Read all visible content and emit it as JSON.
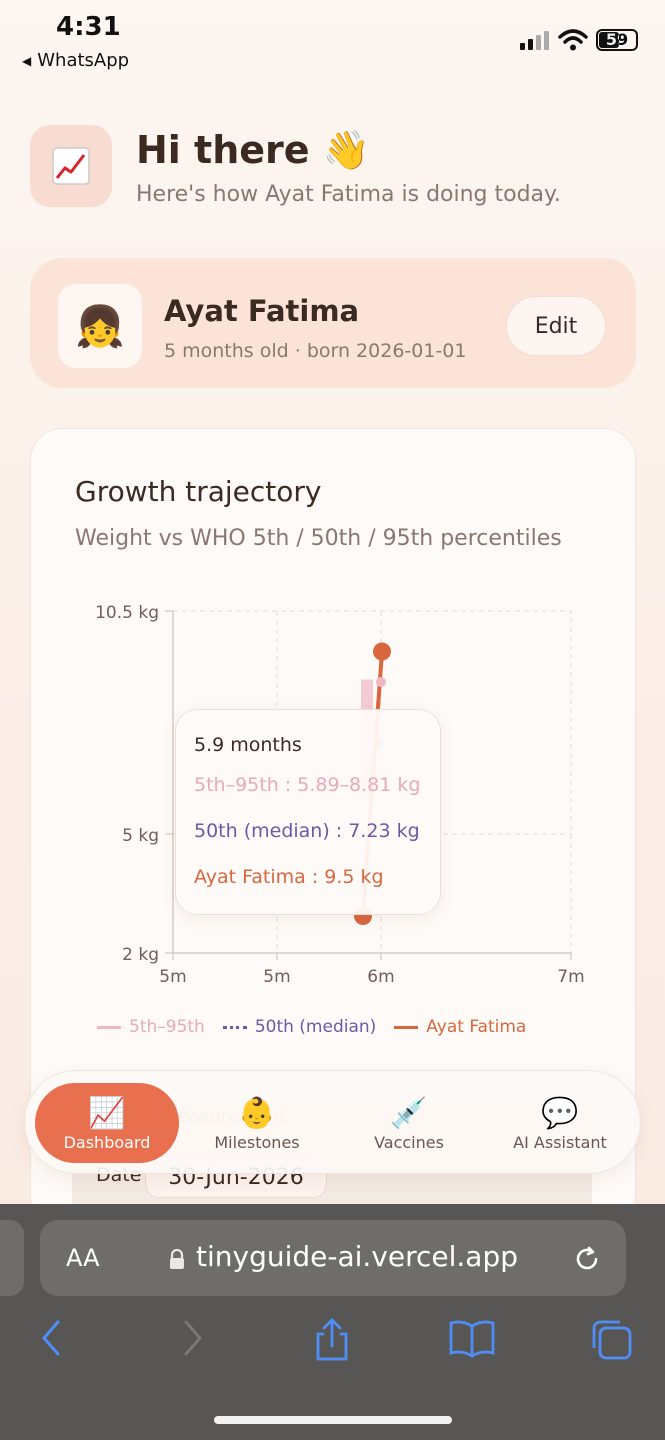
{
  "status_bar": {
    "time": "4:31",
    "back_app": "WhatsApp",
    "battery": "59"
  },
  "header": {
    "logo_icon": "chart-emoji-icon",
    "greeting": "Hi there 👋",
    "subtitle": "Here's how Ayat Fatima is doing today."
  },
  "profile": {
    "avatar_emoji": "👧",
    "name": "Ayat Fatima",
    "meta": "5 months old · born 2026-01-01",
    "edit_label": "Edit"
  },
  "growth": {
    "title": "Growth trajectory",
    "subtitle": "Weight vs WHO 5th / 50th / 95th percentiles",
    "tooltip": {
      "heading": "5.9 months",
      "band": "5th–95th : 5.89–8.81 kg",
      "median": "50th (median) : 7.23 kg",
      "child": "Ayat Fatima : 9.5 kg"
    },
    "legend": [
      "5th–95th",
      "50th (median)",
      "Ayat Fatima"
    ]
  },
  "chart_data": {
    "type": "line",
    "title": "Growth trajectory",
    "subtitle": "Weight vs WHO 5th / 50th / 95th percentiles",
    "y_tick_labels": [
      "10.5 kg",
      "5 kg",
      "2 kg"
    ],
    "y_ticks": [
      10.5,
      5,
      2
    ],
    "x_tick_labels": [
      "5m",
      "5m",
      "6m",
      "7m"
    ],
    "series": [
      {
        "name": "5th–95th",
        "x": [
          5.9
        ],
        "low": [
          5.89
        ],
        "high": [
          8.81
        ],
        "color": "#f0b6c4"
      },
      {
        "name": "50th (median)",
        "x": [
          5.9
        ],
        "y": [
          7.23
        ],
        "color": "#6b5ba7"
      },
      {
        "name": "Ayat Fatima",
        "x": [
          5.8,
          5.9
        ],
        "y": [
          3.6,
          9.5
        ],
        "color": "#d8673f"
      }
    ],
    "grid": true,
    "legend_position": "bottom"
  },
  "log_measurement": {
    "label_partial": "easurement",
    "date_label": "Date",
    "date_value": "30-Jun-2026"
  },
  "nav": {
    "items": [
      {
        "label": "Dashboard",
        "icon": "📈"
      },
      {
        "label": "Milestones",
        "icon": "👶"
      },
      {
        "label": "Vaccines",
        "icon": "💉"
      },
      {
        "label": "AI Assistant",
        "icon": "💬"
      }
    ]
  },
  "browser": {
    "aa_label": "AA",
    "url": "tinyguide-ai.vercel.app"
  },
  "colors": {
    "accent": "#e8704f",
    "background": "#fbefe8",
    "median": "#6b5ba7",
    "band": "#f0b6c4"
  }
}
